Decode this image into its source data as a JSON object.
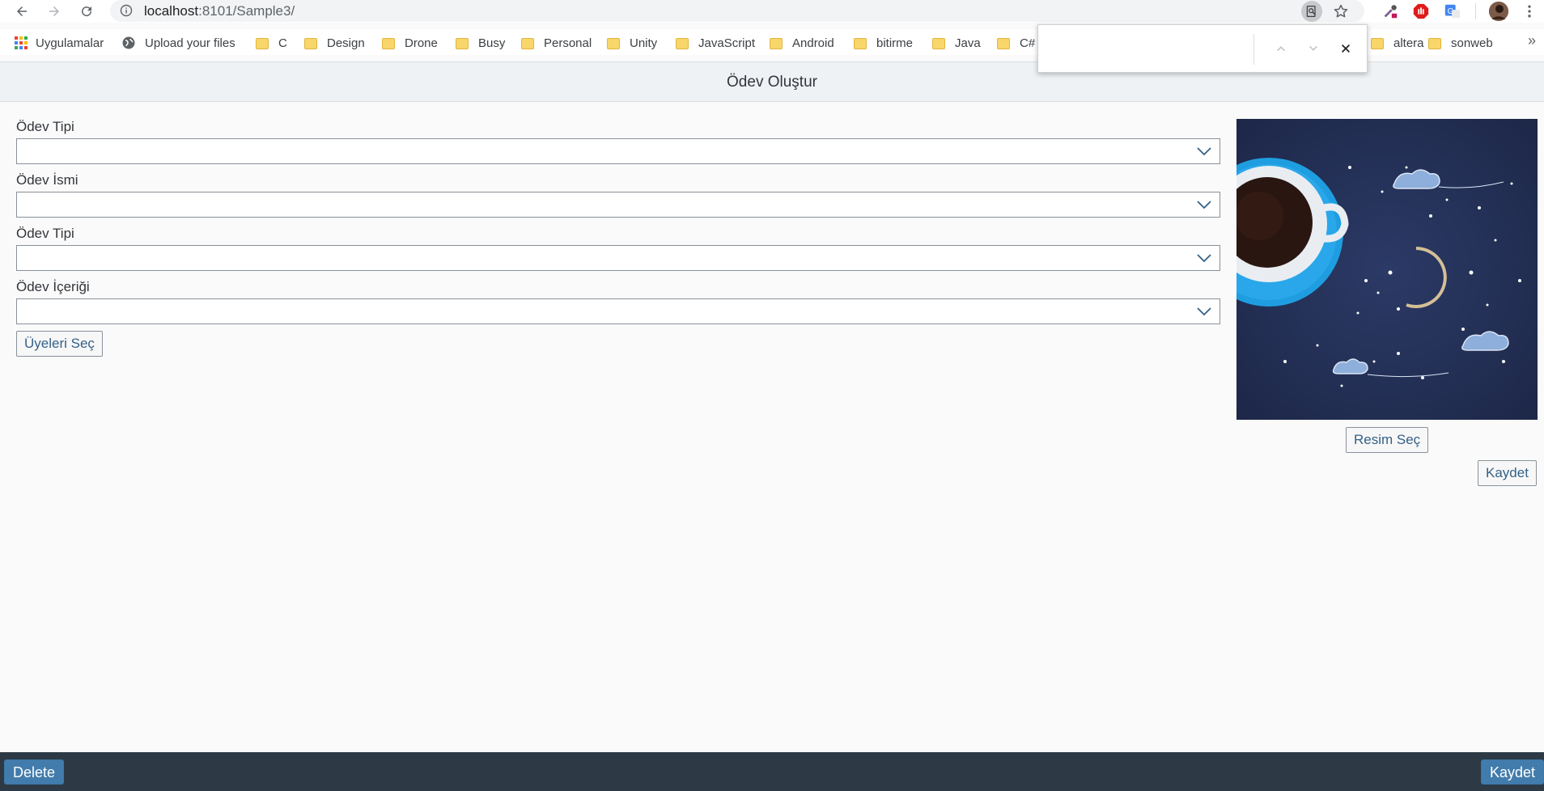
{
  "browser": {
    "url_host": "localhost",
    "url_path": ":8101/Sample3/",
    "bookmarks": [
      "Uygulamalar",
      "Upload your files",
      "C",
      "Design",
      "Drone",
      "Busy",
      "Personal",
      "Unity",
      "JavaScript",
      "Android",
      "bitirme",
      "Java",
      "C#",
      "altera",
      "sonweb"
    ],
    "more_bookmarks": "»"
  },
  "find_bar": {
    "value": ""
  },
  "app": {
    "title": "Ödev Oluştur",
    "fields": [
      {
        "label": "Ödev Tipi",
        "value": ""
      },
      {
        "label": "Ödev İsmi",
        "value": ""
      },
      {
        "label": "Ödev Tipi",
        "value": ""
      },
      {
        "label": "Ödev İçeriği",
        "value": ""
      }
    ],
    "members_button": "Üyeleri Seç",
    "image_button": "Resim Seç",
    "save_button": "Kaydet"
  },
  "footer": {
    "delete_label": "Delete",
    "save_label": "Kaydet"
  },
  "colors": {
    "header_bg": "#eef2f5",
    "footer_bg": "#2d3a45",
    "footer_button": "#427cac",
    "link_text": "#346187"
  }
}
